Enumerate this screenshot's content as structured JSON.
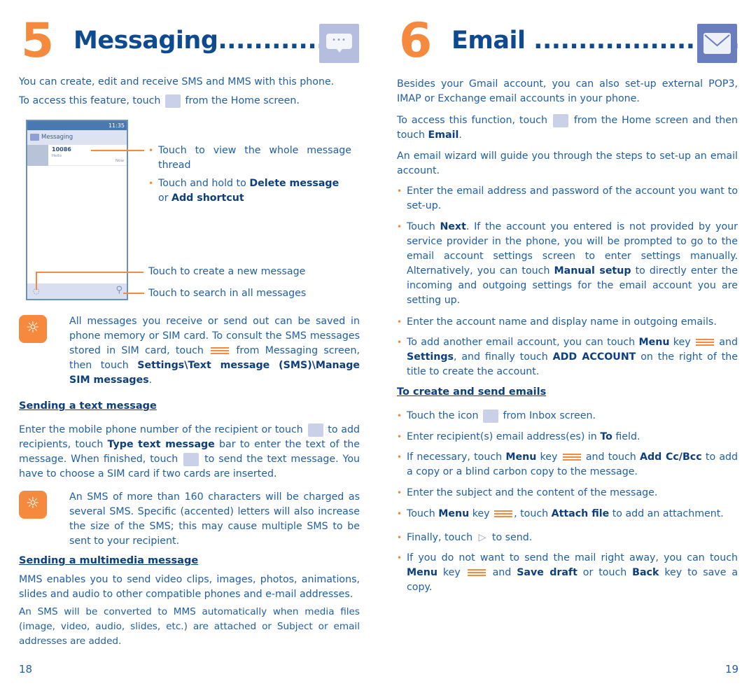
{
  "left_page": {
    "chapter_number": "5",
    "chapter_title": "Messaging................",
    "chapter_icon": "messaging-icon",
    "intro_1": "You can create, edit and receive SMS and MMS with this phone.",
    "intro_2a": "To access this feature, touch",
    "intro_2b": "from the Home screen.",
    "phone": {
      "status_time": "11:35",
      "app_title": "Messaging",
      "thread_number": "10086",
      "thread_preview": "Hello",
      "thread_time": "Now"
    },
    "callouts": {
      "view_thread": "Touch to view the whole message thread",
      "hold_a": "Touch and hold to",
      "hold_b": "Delete message",
      "hold_c": "or",
      "hold_d": "Add shortcut",
      "new_message": "Touch to create a new message",
      "search": "Touch to search in all messages"
    },
    "tip1": {
      "a": "All messages you receive or send out can be saved in phone memory or SIM card. To consult the SMS messages stored in SIM card, touch",
      "b": "from Messaging screen, then touch",
      "c": "Settings\\Text message (SMS)\\Manage SIM messages",
      "d": "."
    },
    "section_text": "Sending a text message",
    "text_para": {
      "a": "Enter the mobile phone number of the recipient or touch",
      "b": "to add recipients, touch",
      "c": "Type text message",
      "d": "bar to enter the text of the message. When finished, touch",
      "e": "to send the text message. You have to choose a SIM card if two cards are inserted."
    },
    "tip2": "An SMS of more than 160 characters will be charged as several SMS. Specific (accented) letters will also increase the size of the SMS; this may cause multiple SMS to be sent to your recipient.",
    "section_mms": "Sending a multimedia message",
    "mms_1": "MMS enables you to send video clips, images, photos, animations, slides and audio to other compatible phones and e-mail addresses.",
    "mms_2": "An SMS will be converted to MMS automatically when media files (image, video, audio, slides, etc.) are attached or Subject or email addresses are added.",
    "page_number": "18"
  },
  "right_page": {
    "chapter_number": "6",
    "chapter_title": "Email .......................",
    "chapter_icon": "email-icon",
    "intro": "Besides your Gmail account, you can also set-up external POP3, IMAP or Exchange email accounts in your phone.",
    "access_a": "To access this function, touch",
    "access_b": "from the Home screen and then touch",
    "access_c": "Email",
    "access_d": ".",
    "wizard": "An email wizard will guide you through the steps to set-up an email account.",
    "setup_bullets": [
      {
        "a": "Enter the email address and password of the account you want to set-up."
      },
      {
        "a": "Touch",
        "b": "Next",
        "c": ". If the account you entered is not provided by your service provider in the phone, you will be prompted to go to the email account settings screen to enter settings manually. Alternatively, you can touch",
        "d": "Manual setup",
        "e": "to directly enter the incoming and outgoing settings for the email account you are setting up."
      },
      {
        "a": "Enter the account name and display name in outgoing emails."
      },
      {
        "a": "To add another email account, you can touch",
        "b": "Menu",
        "c": "key",
        "d": "and",
        "e": "Settings",
        "f": ", and finally touch",
        "g": "ADD ACCOUNT",
        "h": "on the right of the title to create the account."
      }
    ],
    "section_create": "To create and send emails",
    "create_bullets": [
      {
        "a": "Touch the icon",
        "b": "from Inbox screen."
      },
      {
        "a": "Enter recipient(s) email address(es) in",
        "b": "To",
        "c": "field."
      },
      {
        "a": "If necessary, touch",
        "b": "Menu",
        "c": "key",
        "d": "and touch",
        "e": "Add Cc/Bcc",
        "f": "to add a copy or a blind carbon copy to the message."
      },
      {
        "a": "Enter the subject and the content of the message."
      },
      {
        "a": "Touch",
        "b": "Menu",
        "c": "key",
        "d": ", touch",
        "e": "Attach file",
        "f": "to add an attachment."
      },
      {
        "a": "Finally, touch",
        "b": "to send."
      },
      {
        "a": "If you do not want to send the mail right away, you can touch",
        "b": "Menu",
        "c": "key",
        "d": "and",
        "e": "Save draft",
        "f": "or touch",
        "g": "Back",
        "h": "key to save a copy."
      }
    ],
    "page_number": "19"
  },
  "colors": {
    "accent_orange": "#f58a3f",
    "title_blue": "#0e4a8f",
    "text_blue": "#1f5fa6"
  }
}
